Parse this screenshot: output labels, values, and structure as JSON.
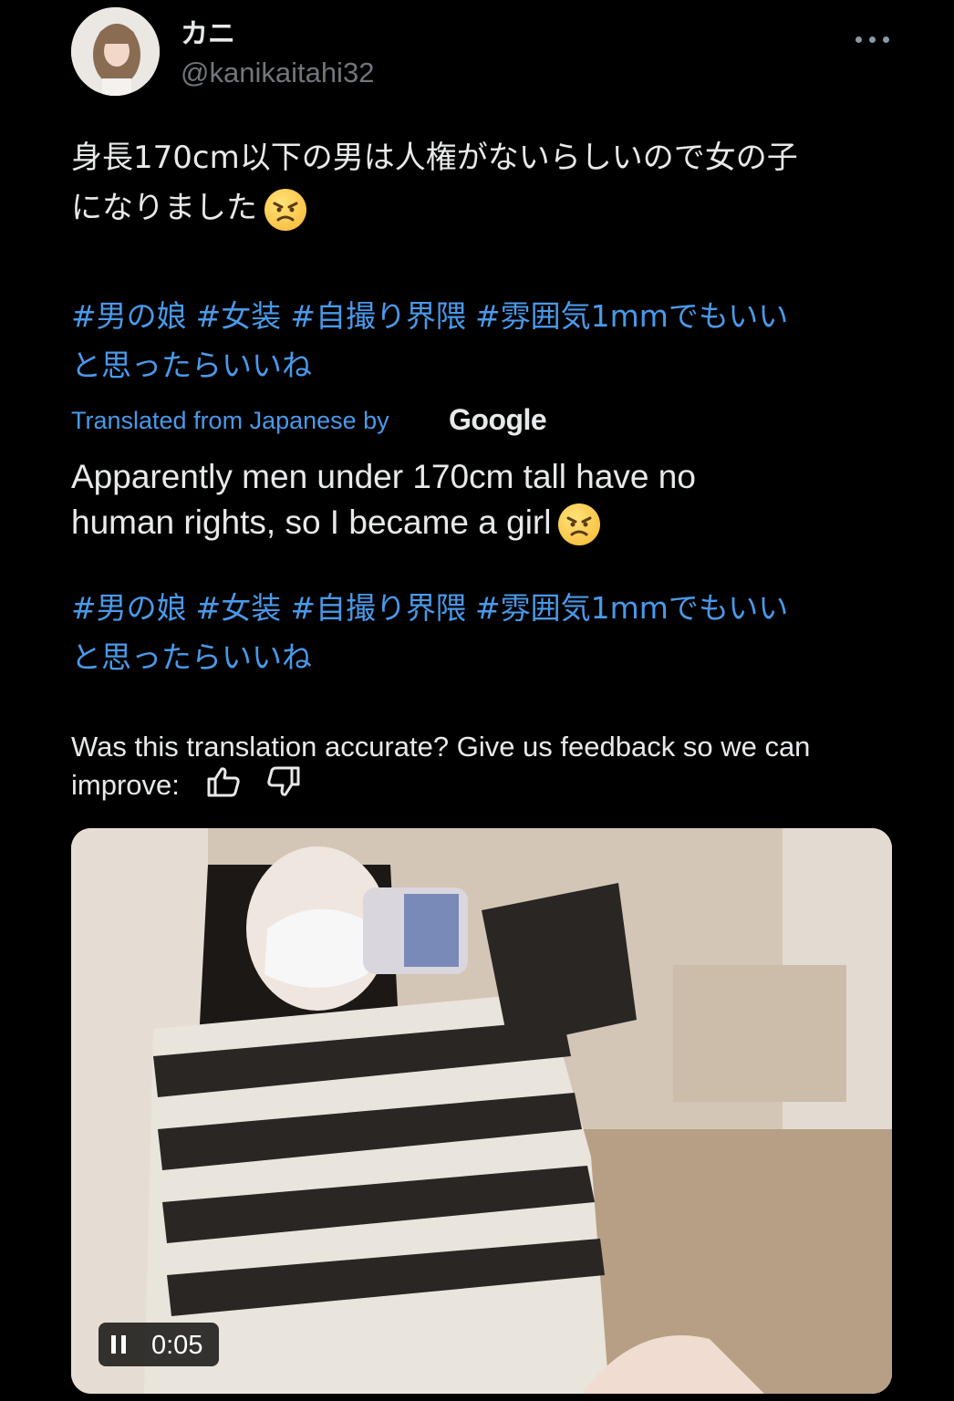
{
  "author": {
    "display_name": "カニ",
    "handle": "@kanikaitahi32"
  },
  "tweet": {
    "text_line1": "身長170cm以下の男は人権がないらしいので女の子",
    "text_line2": "になりました",
    "emoji": "angry-face-emoji",
    "hashtags": [
      "#男の娘",
      "#女装",
      "#自撮り界隈",
      "#雰囲気1mmでもいい"
    ],
    "hashtags_line2": "と思ったらいいね"
  },
  "translation": {
    "label": "Translated from Japanese by",
    "provider": "Google",
    "text_line1": "Apparently men under 170cm tall have no",
    "text_line2": "human rights, so I became a girl",
    "hashtags": [
      "#男の娘",
      "#女装",
      "#自撮り界隈",
      "#雰囲気1mmでもいい"
    ],
    "hashtags_line2": "と思ったらいいね"
  },
  "feedback": {
    "prompt_line1": "Was this translation accurate? Give us feedback so we can",
    "prompt_line2": "improve:",
    "icons": [
      "thumbs-up-icon",
      "thumbs-down-icon"
    ]
  },
  "media": {
    "type": "video",
    "timestamp": "0:05",
    "state_icon": "pause-icon"
  },
  "colors": {
    "background": "#000000",
    "text": "#e7e9ea",
    "secondary": "#71767b",
    "link": "#4a99e9"
  }
}
